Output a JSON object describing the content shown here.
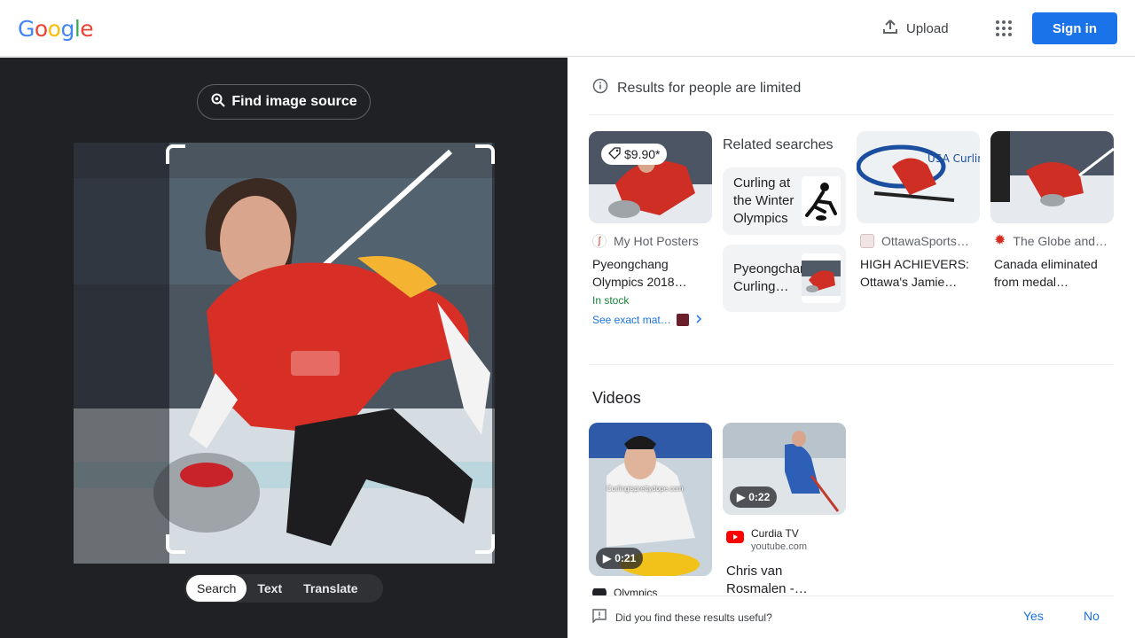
{
  "header": {
    "logo_letters": [
      {
        "ch": "G",
        "color": "#4285F4"
      },
      {
        "ch": "o",
        "color": "#EA4335"
      },
      {
        "ch": "o",
        "color": "#FBBC05"
      },
      {
        "ch": "g",
        "color": "#4285F4"
      },
      {
        "ch": "l",
        "color": "#34A853"
      },
      {
        "ch": "e",
        "color": "#EA4335"
      }
    ],
    "upload_label": "Upload",
    "apps_icon": "apps-grid-icon",
    "signin_label": "Sign in"
  },
  "left_panel": {
    "find_source_label": "Find image source",
    "modes": [
      {
        "label": "Search",
        "active": true
      },
      {
        "label": "Text",
        "active": false
      },
      {
        "label": "Translate",
        "active": false
      }
    ]
  },
  "right_panel": {
    "notice": "Results for people are limited",
    "results": [
      {
        "price": "$9.90*",
        "source": "My Hot Posters",
        "title_lines": [
          "Pyeongchang",
          "Olympics 2018…"
        ],
        "stock": "In stock",
        "exact_match": "See exact mat…"
      },
      {
        "source": "OttawaSports…",
        "title_lines": [
          "HIGH ACHIEVERS:",
          "Ottawa's Jamie…"
        ]
      },
      {
        "source": "The Globe and…",
        "title_lines": [
          "Canada eliminated",
          "from medal…"
        ]
      }
    ],
    "related": {
      "title": "Related searches",
      "items": [
        {
          "label": "Curling at the Winter Olympics"
        },
        {
          "label": "Pyeongchang Curling…"
        }
      ]
    },
    "videos": {
      "title": "Videos",
      "items": [
        {
          "duration": "0:21",
          "source": "Olympics",
          "caption": "Curlingisprettydope.com"
        },
        {
          "duration": "0:22",
          "source": "Curdia TV",
          "domain": "youtube.com",
          "title_lines": [
            "Chris van",
            "Rosmalen -…"
          ]
        }
      ]
    },
    "feedback": {
      "question": "Did you find these results useful?",
      "yes": "Yes",
      "no": "No"
    }
  }
}
